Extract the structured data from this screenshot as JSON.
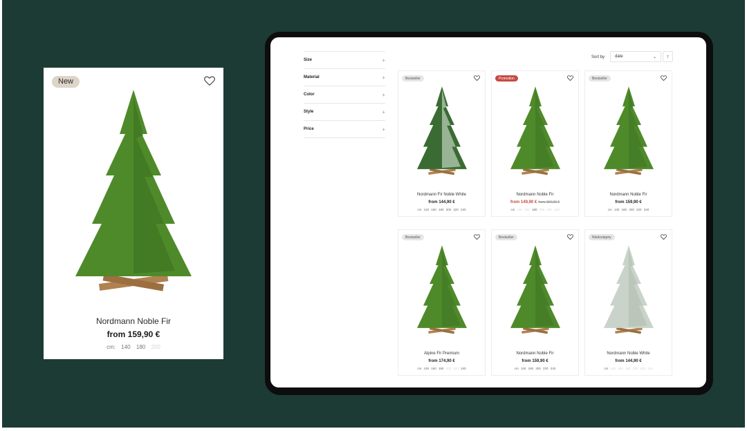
{
  "colors": {
    "background": "#1c3b34",
    "promo": "#c64a43",
    "new_badge": "#ddd5c7"
  },
  "featured": {
    "badge": "New",
    "name": "Nordmann Noble Fir",
    "price": "from 159,90 €",
    "sizes_label": "cm:",
    "sizes": [
      "140",
      "180",
      "200"
    ],
    "sizes_available": [
      true,
      true,
      false
    ]
  },
  "filters": [
    "Size",
    "Material",
    "Color",
    "Style",
    "Price"
  ],
  "sort": {
    "label": "Sort by",
    "value": "date"
  },
  "products": [
    {
      "badge": "Bestseller",
      "name": "Nordmann Fir Noble White",
      "price": "from 144,90 €",
      "old_price": "",
      "sizes_label": "cm",
      "sizes": [
        "140",
        "160",
        "180",
        "200",
        "220",
        "240"
      ],
      "available": [
        true,
        true,
        true,
        true,
        true,
        true
      ]
    },
    {
      "badge": "Promotion",
      "name": "Nordmann Noble Fir",
      "price": "from 149,90 €",
      "old_price": "from 159,90 €",
      "sizes_label": "cm",
      "sizes": [
        "140",
        "160",
        "180",
        "200",
        "220",
        "240"
      ],
      "available": [
        false,
        false,
        true,
        false,
        false,
        false
      ]
    },
    {
      "badge": "Bestseller",
      "name": "Nordmann Noble Fir",
      "price": "from 159,90 €",
      "old_price": "",
      "sizes_label": "cm",
      "sizes": [
        "140",
        "180",
        "200",
        "220",
        "240"
      ],
      "available": [
        true,
        true,
        true,
        true,
        true
      ]
    },
    {
      "badge": "Bestseller",
      "name": "Alpine Fir Premium",
      "price": "from 174,90 €",
      "old_price": "",
      "sizes_label": "cm",
      "sizes": [
        "140",
        "160",
        "180",
        "200",
        "220",
        "240"
      ],
      "available": [
        true,
        true,
        true,
        false,
        false,
        true
      ]
    },
    {
      "badge": "Bestseller",
      "name": "Nordmann Noble Fir",
      "price": "from 159,90 €",
      "old_price": "",
      "sizes_label": "cm",
      "sizes": [
        "140",
        "180",
        "200",
        "220",
        "240"
      ],
      "available": [
        true,
        true,
        true,
        true,
        true
      ]
    },
    {
      "badge": "Niedostępny",
      "name": "Nordmann Noble White",
      "price": "from 144,90 €",
      "old_price": "",
      "sizes_label": "cm",
      "sizes": [
        "140",
        "160",
        "180",
        "200",
        "220",
        "240"
      ],
      "available": [
        false,
        false,
        false,
        false,
        false,
        false
      ]
    }
  ]
}
